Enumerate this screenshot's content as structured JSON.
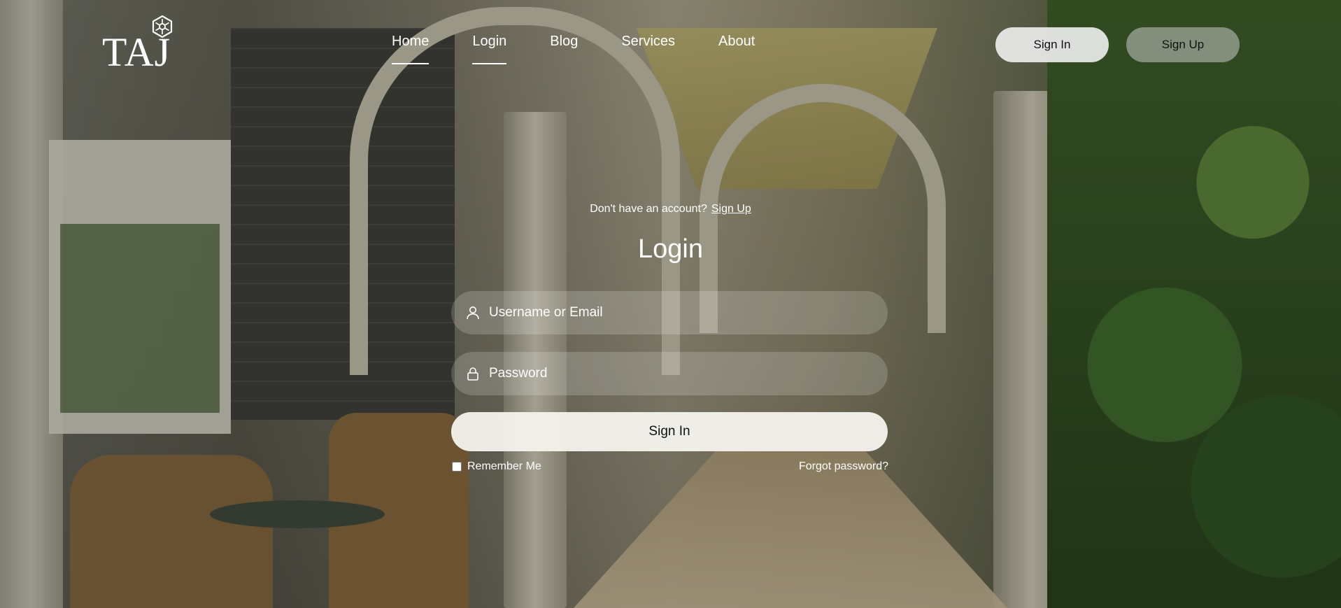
{
  "brand": {
    "name": "TAJ",
    "logo_icon": "hexagon-emblem-icon"
  },
  "nav": {
    "items": [
      {
        "label": "Home",
        "active": true
      },
      {
        "label": "Login",
        "active": true
      },
      {
        "label": "Blog",
        "active": false
      },
      {
        "label": "Services",
        "active": false
      },
      {
        "label": "About",
        "active": false
      }
    ]
  },
  "header_buttons": {
    "sign_in": "Sign In",
    "sign_up": "Sign Up"
  },
  "login": {
    "prompt_text": "Don't have an account?",
    "prompt_link": "Sign Up",
    "title": "Login",
    "username_placeholder": "Username or Email",
    "username_icon": "user-icon",
    "password_placeholder": "Password",
    "password_icon": "lock-icon",
    "submit_label": "Sign In",
    "remember_label": "Remember Me",
    "remember_checked": false,
    "forgot_label": "Forgot password?"
  },
  "colors": {
    "text": "#ffffff",
    "button_light": "#f5f3ee",
    "overlay": "#141612"
  }
}
